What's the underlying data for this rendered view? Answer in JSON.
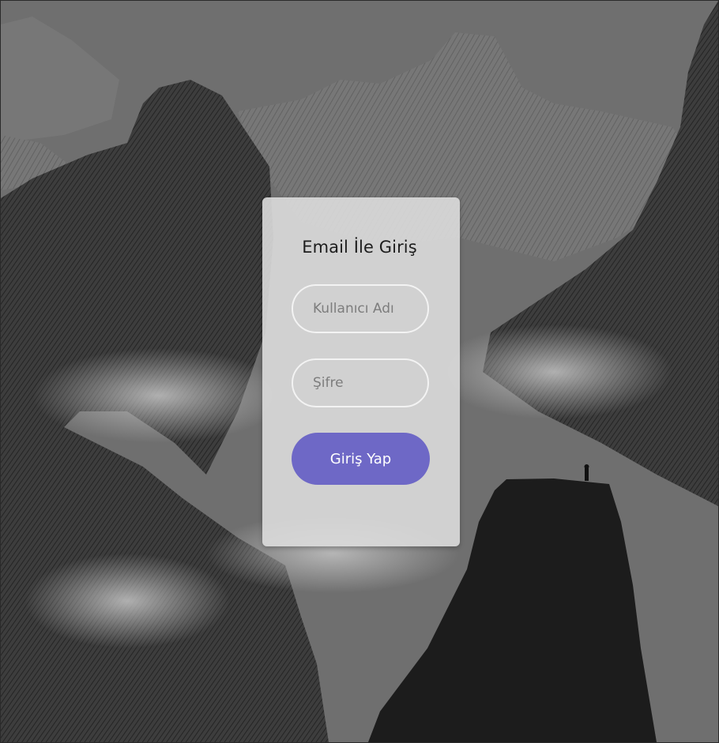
{
  "login": {
    "title": "Email İle Giriş",
    "username_placeholder": "Kullanıcı Adı",
    "password_placeholder": "Şifre",
    "submit_label": "Giriş Yap"
  },
  "colors": {
    "accent": "#6e68c6",
    "background": "#6f6f6f",
    "card": "#d9d9d9"
  }
}
